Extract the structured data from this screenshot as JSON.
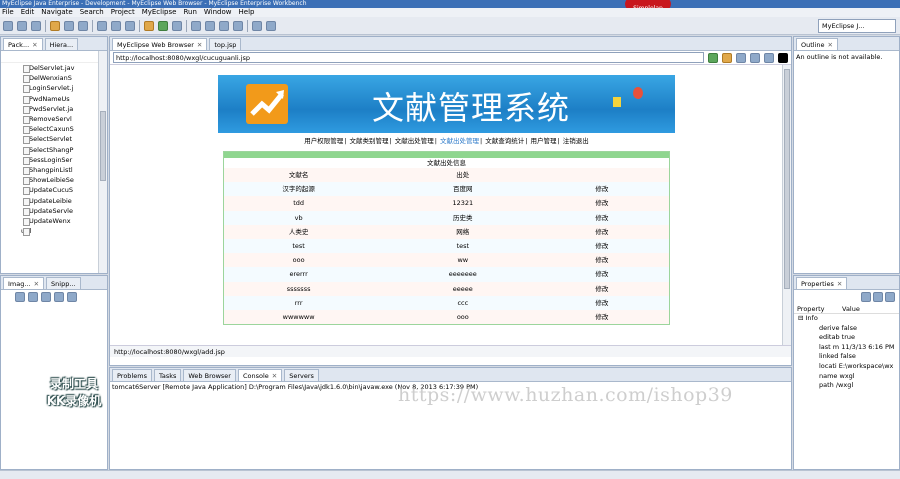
{
  "window": {
    "title": "MyEclipse Java Enterprise - Development - MyEclipse Web Browser - MyEclipse Enterprise Workbench",
    "badge": "Simplelap"
  },
  "menu": [
    "File",
    "Edit",
    "Navigate",
    "Search",
    "Project",
    "MyEclipse",
    "Run",
    "Window",
    "Help"
  ],
  "perspective": "MyEclipse J...",
  "left_panel": {
    "tabs": [
      "Pack...",
      "Hiera..."
    ],
    "tree": [
      "DelServlet.jav",
      "DelWenxianS",
      "LoginServlet.j",
      "PwdNameUs",
      "PwdServlet.ja",
      "RemoveServl",
      "SelectCaxunS",
      "SelectServlet",
      "SelectShangP",
      "SessLoginSer",
      "ShangpinListl",
      "ShowLeibieSe",
      "UpdateCucuS",
      "UpdateLeibie",
      "UpdateServle",
      "UpdateWenx",
      "util"
    ]
  },
  "left_bottom": {
    "tabs": [
      "Imag...",
      "Snipp..."
    ]
  },
  "editor": {
    "tabs": [
      "MyEclipse Web Browser",
      "top.jsp"
    ],
    "url": "http://localhost:8080/wxgl/cucuguanli.jsp",
    "status_url": "http://localhost:8080/wxgl/add.jsp"
  },
  "page": {
    "banner_title": "文献管理系统",
    "nav": [
      "用户权限管理",
      "文献类别管理",
      "文献出处管理",
      "文献出处管理",
      "文献查询统计",
      "用户管理",
      "注销退出"
    ],
    "table_title": "文献出处信息",
    "headers": [
      "文献名",
      "出处",
      ""
    ],
    "rows": [
      {
        "name": "汉字的起源",
        "source": "百度网",
        "action": "修改"
      },
      {
        "name": "tdd",
        "source": "12321",
        "action": "修改"
      },
      {
        "name": "vb",
        "source": "历史类",
        "action": "修改"
      },
      {
        "name": "人类史",
        "source": "网络",
        "action": "修改"
      },
      {
        "name": "test",
        "source": "test",
        "action": "修改"
      },
      {
        "name": "ooo",
        "source": "ww",
        "action": "修改"
      },
      {
        "name": "ererrr",
        "source": "eeeeeee",
        "action": "修改"
      },
      {
        "name": "sssssss",
        "source": "eeeee",
        "action": "修改"
      },
      {
        "name": "rrr",
        "source": "ccc",
        "action": "修改"
      },
      {
        "name": "wwwwww",
        "source": "ooo",
        "action": "修改"
      }
    ]
  },
  "outline": {
    "tab": "Outline",
    "message": "An outline is not available."
  },
  "properties": {
    "tab": "Properties",
    "headers": [
      "Property",
      "Value"
    ],
    "group": "Info",
    "rows": [
      "derive false",
      "editab true",
      "last m 11/3/13 6:16 PM",
      "linked false",
      "locati E:\\workspace\\wx",
      "name wxgl",
      "path /wxgl"
    ]
  },
  "bottom": {
    "tabs": [
      "Problems",
      "Tasks",
      "Web Browser",
      "Console",
      "Servers"
    ],
    "console_line": "tomcat6Server [Remote Java Application] D:\\Program Files\\Java\\jdk1.6.0\\bin\\javaw.exe (Nov 8, 2013 6:17:39 PM)"
  },
  "overlay": {
    "recorder": "录制工具\nKK录像机",
    "watermark": "https://www.huzhan.com/ishop39"
  }
}
